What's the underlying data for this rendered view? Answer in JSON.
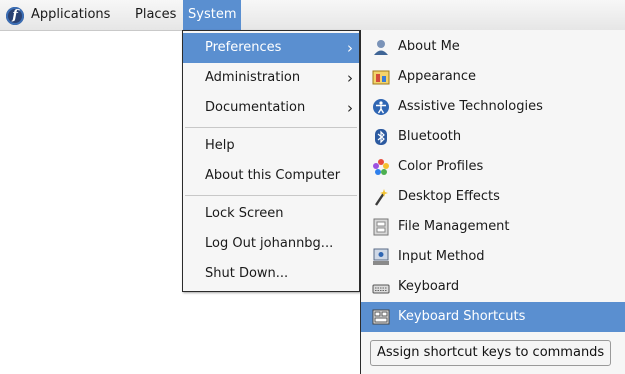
{
  "topbar": {
    "applications": "Applications",
    "places": "Places",
    "system": "System"
  },
  "system_menu": {
    "items": [
      {
        "label": "Preferences",
        "submenu": true,
        "active": true
      },
      {
        "label": "Administration",
        "submenu": true
      },
      {
        "label": "Documentation",
        "submenu": true
      },
      {
        "label": "Help"
      },
      {
        "label": "About this Computer"
      },
      {
        "label": "Lock Screen"
      },
      {
        "label": "Log Out johannbg..."
      },
      {
        "label": "Shut Down..."
      }
    ],
    "arrow": "›"
  },
  "preferences_menu": {
    "items": [
      {
        "label": "About Me",
        "icon": "about-me-icon"
      },
      {
        "label": "Appearance",
        "icon": "appearance-icon"
      },
      {
        "label": "Assistive Technologies",
        "icon": "accessibility-icon"
      },
      {
        "label": "Bluetooth",
        "icon": "bluetooth-icon"
      },
      {
        "label": "Color Profiles",
        "icon": "color-profiles-icon"
      },
      {
        "label": "Desktop Effects",
        "icon": "desktop-effects-icon"
      },
      {
        "label": "File Management",
        "icon": "file-management-icon"
      },
      {
        "label": "Input Method",
        "icon": "input-method-icon"
      },
      {
        "label": "Keyboard",
        "icon": "keyboard-icon"
      },
      {
        "label": "Keyboard Shortcuts",
        "icon": "keyboard-shortcuts-icon",
        "active": true
      }
    ]
  },
  "tooltip": "Assign shortcut keys to commands",
  "colors": {
    "highlight": "#5a8fd0",
    "menu_bg": "#f6f6f6",
    "border": "#2b2b2b"
  }
}
